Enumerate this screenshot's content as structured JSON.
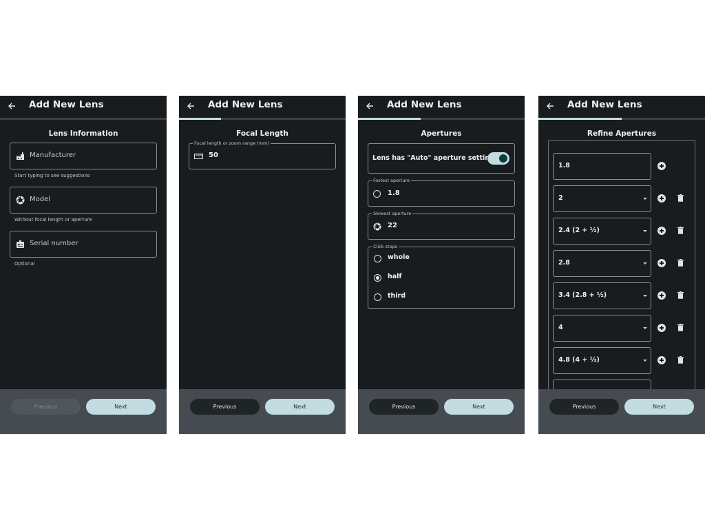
{
  "app": {
    "title": "Add New Lens"
  },
  "screens": [
    {
      "step": 1,
      "progress_fraction": 0.0,
      "section_title": "Lens Information",
      "fields": [
        {
          "icon": "factory-icon",
          "placeholder": "Manufacturer",
          "helper": "Start typing to see suggestions"
        },
        {
          "icon": "aperture-icon",
          "placeholder": "Model",
          "helper": "Without focal length or aperture"
        },
        {
          "icon": "badge-icon",
          "placeholder": "Serial number",
          "helper": "Optional"
        }
      ],
      "previous_label": "Previous",
      "previous_disabled": true,
      "next_label": "Next"
    },
    {
      "step": 2,
      "progress_fraction": 0.25,
      "section_title": "Focal Length",
      "focal_field": {
        "label": "Focal length or zoom range (mm)",
        "value": "50",
        "icon": "ruler-icon"
      },
      "previous_label": "Previous",
      "next_label": "Next"
    },
    {
      "step": 3,
      "progress_fraction": 0.375,
      "section_title": "Apertures",
      "auto_toggle": {
        "label": "Lens has \"Auto\" aperture setting",
        "on": true
      },
      "fastest": {
        "label": "Fastest aperture",
        "value": "1.8",
        "icon": "circle-icon"
      },
      "slowest": {
        "label": "Slowest aperture",
        "value": "22",
        "icon": "aperture-icon"
      },
      "click_stops": {
        "label": "Click stops",
        "options": [
          "whole",
          "half",
          "third"
        ],
        "selected": "half"
      },
      "previous_label": "Previous",
      "next_label": "Next"
    },
    {
      "step": 4,
      "progress_fraction": 0.5,
      "section_title": "Refine Apertures",
      "apertures": [
        {
          "value": "1.8",
          "dropdown": false,
          "deletable": false
        },
        {
          "value": "2",
          "dropdown": true,
          "deletable": true
        },
        {
          "value": "2.4 (2 + ½)",
          "dropdown": true,
          "deletable": true
        },
        {
          "value": "2.8",
          "dropdown": true,
          "deletable": true
        },
        {
          "value": "3.4 (2.8 + ½)",
          "dropdown": true,
          "deletable": true
        },
        {
          "value": "4",
          "dropdown": true,
          "deletable": true
        },
        {
          "value": "4.8 (4 + ½)",
          "dropdown": true,
          "deletable": true
        }
      ],
      "previous_label": "Previous",
      "next_label": "Next"
    }
  ]
}
